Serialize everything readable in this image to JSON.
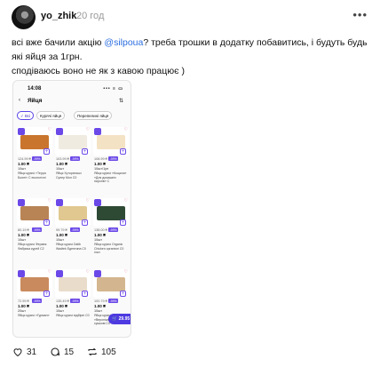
{
  "post": {
    "author": "yo_zhik",
    "time": "20 год",
    "more_icon": "more-dots-icon",
    "text_line1_pre": "всі вже бачили акцію ",
    "mention": "@silpoua",
    "text_line1_post": "? треба трошки в додатку побавитись, і будуть будь",
    "text_line2": "які яйця за 1грн.",
    "text_line3": "сподіваюсь воно не як з кавою працює )"
  },
  "screenshot": {
    "status_time": "14:08",
    "status_icons": "••• ≡ ▭",
    "title": "Яйця",
    "back_icon": "chevron-left-icon",
    "sort_icon": "sort-icon",
    "chips": [
      {
        "label": "✓ Всі",
        "active": true
      },
      {
        "label": "Курячі яйця",
        "active": false
      },
      {
        "label": "Перепелині яйця",
        "active": false
      }
    ],
    "products": [
      {
        "old_price": "124.99 ₴",
        "discount": "-99%",
        "price": "1.00 ₴",
        "weight": "10шт",
        "name": "Яйця курячі «Терра Бьюті» С екологічні",
        "egg_color": "#c9752e"
      },
      {
        "old_price": "103.99 ₴",
        "discount": "-99%",
        "price": "1.00 ₴",
        "weight": "10шт",
        "name": "Яйця Хуторянські Супер Мол С0",
        "egg_color": "#f0ebe0"
      },
      {
        "old_price": "108.99 ₴",
        "discount": "-99%",
        "price": "1.00 ₴",
        "weight": "10шт/1уп",
        "name": "Яйця курячі «Кощичи» «Для домашніх пирогів» С",
        "egg_color": "#f4e2c4"
      },
      {
        "old_price": "80.19 ₴",
        "discount": "-99%",
        "price": "1.00 ₴",
        "weight": "10шт",
        "name": "Яйця курячі Фермек Фабрика курей С2",
        "egg_color": "#b88456"
      },
      {
        "old_price": "99.79 ₴",
        "discount": "-99%",
        "price": "1.00 ₴",
        "weight": "10шт",
        "name": "Яйця курячі Dalib Wadtek Едентина С0",
        "egg_color": "#e0c890"
      },
      {
        "old_price": "138.00 ₴",
        "discount": "-99%",
        "price": "1.00 ₴",
        "weight": "10шт",
        "name": "Яйця курячі Organic Chicken органічні С0 ільн",
        "egg_color": "#2e4a34"
      },
      {
        "old_price": "72.99 ₴",
        "discount": "-99%",
        "price": "1.00 ₴",
        "weight": "20шт",
        "name": "Яйця курячі «Гурман»",
        "egg_color": "#c98a5e"
      },
      {
        "old_price": "135.49 ₴",
        "discount": "-99%",
        "price": "1.00 ₴",
        "weight": "10шт",
        "name": "Яйця курячі відбірні С0",
        "egg_color": "#e9dccb"
      },
      {
        "old_price": "100.79 ₴",
        "discount": "-99%",
        "price": "1.00 ₴",
        "weight": "10шт",
        "name": "Яйця курячі «Вероніка» відбірні сушкові С0",
        "egg_color": "#d3b68f"
      }
    ],
    "cart": "🛒 29.95 ₴"
  },
  "actions": [
    {
      "icon": "heart-icon",
      "count": "31"
    },
    {
      "icon": "comment-icon",
      "count": "15"
    },
    {
      "icon": "repost-icon",
      "count": "105"
    }
  ]
}
